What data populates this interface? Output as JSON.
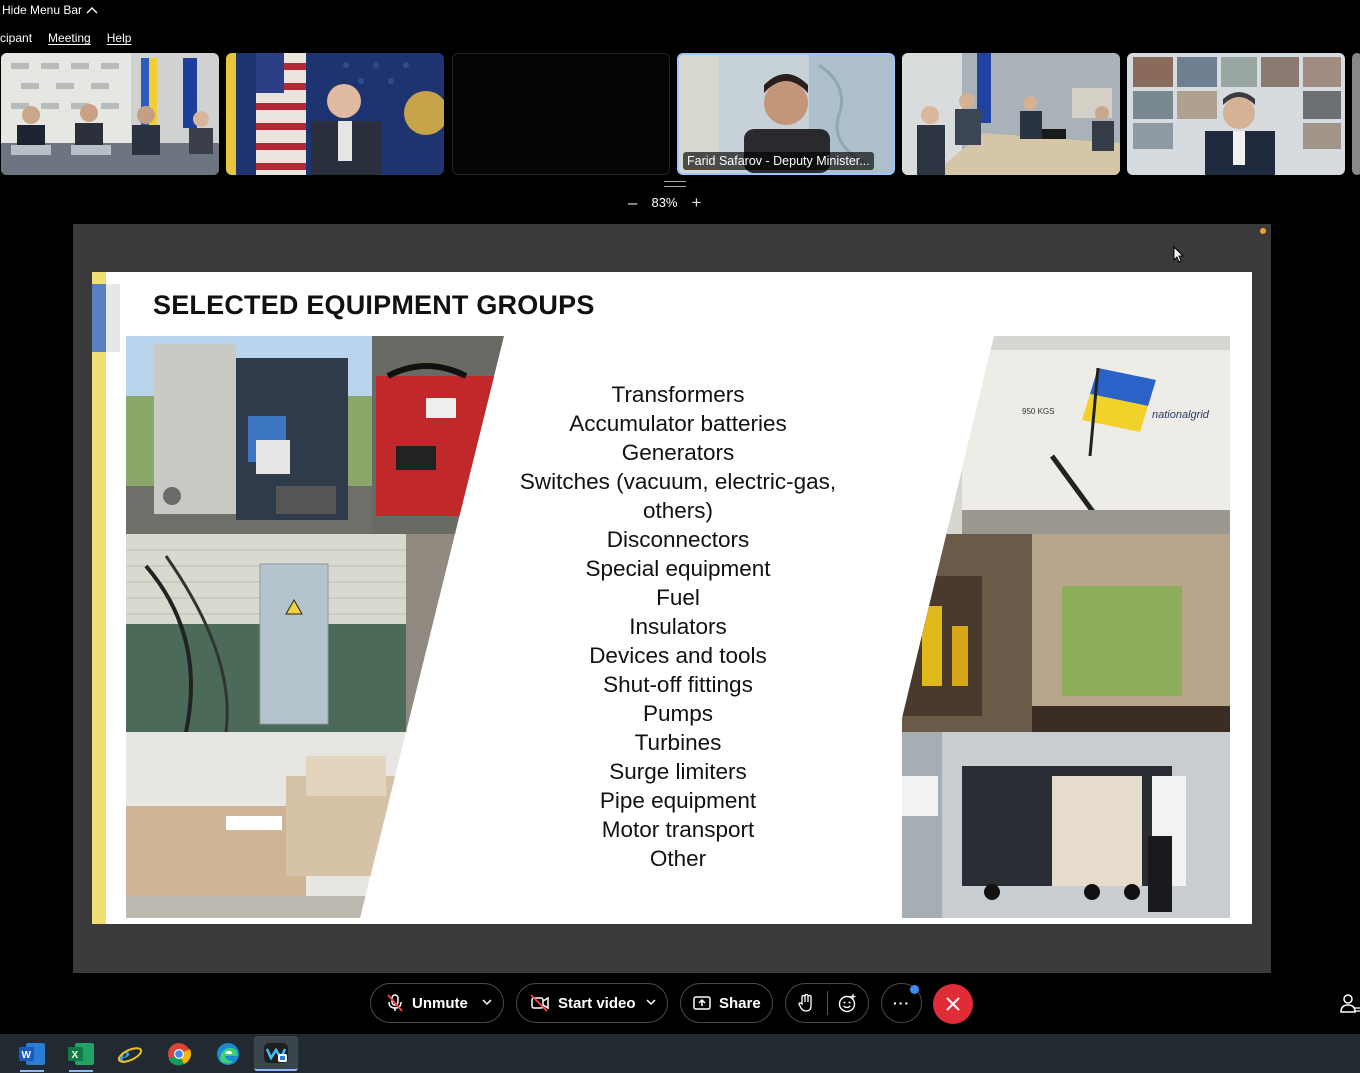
{
  "menu": {
    "hide_menu_bar": "Hide Menu Bar",
    "items": [
      "cipant",
      "Meeting",
      "Help"
    ]
  },
  "thumbnails": [
    {
      "name": ""
    },
    {
      "name": ""
    },
    {
      "name": ""
    },
    {
      "name": "Farid Safarov - Deputy Minister..."
    },
    {
      "name": ""
    },
    {
      "name": ""
    }
  ],
  "zoom": {
    "value": "83%",
    "minus": "–",
    "plus": "+"
  },
  "slide": {
    "title": "SELECTED EQUIPMENT GROUPS",
    "items": [
      "Transformers",
      "Accumulator batteries",
      "Generators",
      "Switches (vacuum, electric-gas,",
      "others)",
      "Disconnectors",
      "Special equipment",
      "Fuel",
      "Insulators",
      "Devices and tools",
      "Shut-off fittings",
      "Pumps",
      "Turbines",
      "Surge limiters",
      "Pipe equipment",
      "Motor transport",
      "Other"
    ],
    "photo_label": "nationalgrid",
    "photo_text_950": "950 KGS"
  },
  "controls": {
    "unmute": "Unmute",
    "start_video": "Start video",
    "share": "Share",
    "more": "···"
  },
  "colors": {
    "slide_yellow": "#f2df72",
    "slide_blue": "#5b80c2",
    "leave_red": "#e02c37",
    "accent_blue": "#3b8ef0"
  },
  "taskbar": {
    "icons": [
      "word-icon",
      "excel-icon",
      "internet-explorer-icon",
      "chrome-icon",
      "edge-icon",
      "webex-icon"
    ]
  }
}
